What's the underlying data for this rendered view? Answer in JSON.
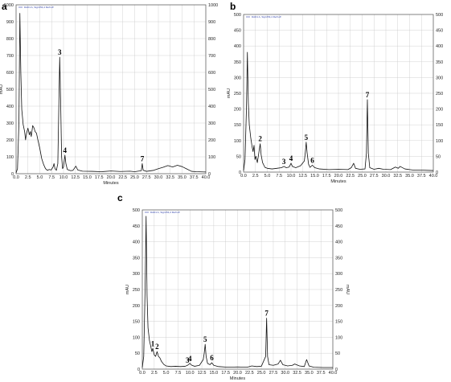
{
  "chart_data": [
    {
      "type": "line",
      "panel": "a",
      "legend_entry": "DAD1 A, Sig=254,4 Ref=off",
      "xlabel": "Minutes",
      "ylabel_left": "mAU",
      "ylabel_right": "",
      "xlim": [
        0,
        40
      ],
      "ylim": [
        0,
        1000
      ],
      "x_ticks": [
        "0.0",
        "2.5",
        "5.0",
        "7.5",
        "10.0",
        "12.5",
        "15.0",
        "17.5",
        "20.0",
        "22.5",
        "25.0",
        "27.5",
        "30.0",
        "32.5",
        "35.0",
        "37.5",
        "40.0"
      ],
      "y_ticks": [
        "0",
        "100",
        "200",
        "300",
        "400",
        "500",
        "600",
        "700",
        "800",
        "900",
        "1000"
      ],
      "grid": true,
      "series": [
        {
          "values": [
            [
              0.0,
              5
            ],
            [
              0.3,
              30
            ],
            [
              0.6,
              300
            ],
            [
              0.8,
              950
            ],
            [
              1.0,
              600
            ],
            [
              1.2,
              380
            ],
            [
              1.5,
              290
            ],
            [
              1.8,
              250
            ],
            [
              2.0,
              200
            ],
            [
              2.2,
              240
            ],
            [
              2.5,
              270
            ],
            [
              2.8,
              230
            ],
            [
              3.0,
              250
            ],
            [
              3.2,
              220
            ],
            [
              3.5,
              285
            ],
            [
              3.8,
              270
            ],
            [
              4.0,
              250
            ],
            [
              4.3,
              240
            ],
            [
              4.6,
              200
            ],
            [
              5.0,
              150
            ],
            [
              5.4,
              90
            ],
            [
              5.8,
              55
            ],
            [
              6.2,
              30
            ],
            [
              6.6,
              20
            ],
            [
              7.0,
              25
            ],
            [
              7.4,
              22
            ],
            [
              7.8,
              40
            ],
            [
              8.0,
              60
            ],
            [
              8.2,
              30
            ],
            [
              8.5,
              20
            ],
            [
              8.8,
              60
            ],
            [
              9.0,
              380
            ],
            [
              9.2,
              690
            ],
            [
              9.4,
              420
            ],
            [
              9.6,
              100
            ],
            [
              9.8,
              30
            ],
            [
              10.0,
              40
            ],
            [
              10.3,
              110
            ],
            [
              10.5,
              60
            ],
            [
              10.8,
              25
            ],
            [
              11.5,
              18
            ],
            [
              12.0,
              20
            ],
            [
              12.6,
              45
            ],
            [
              13.0,
              22
            ],
            [
              14.0,
              15
            ],
            [
              16.0,
              14
            ],
            [
              18.0,
              12
            ],
            [
              20.0,
              16
            ],
            [
              22.0,
              13
            ],
            [
              24.0,
              15
            ],
            [
              25.0,
              12
            ],
            [
              26.4,
              18
            ],
            [
              26.6,
              60
            ],
            [
              26.8,
              20
            ],
            [
              27.5,
              14
            ],
            [
              29.0,
              20
            ],
            [
              30.0,
              30
            ],
            [
              31.0,
              38
            ],
            [
              32.0,
              48
            ],
            [
              33.0,
              40
            ],
            [
              34.0,
              50
            ],
            [
              35.0,
              42
            ],
            [
              36.0,
              28
            ],
            [
              37.0,
              14
            ],
            [
              38.0,
              12
            ],
            [
              40.0,
              10
            ]
          ]
        }
      ],
      "peaks": [
        {
          "label": "3",
          "x": 9.2,
          "y": 690
        },
        {
          "label": "4",
          "x": 10.3,
          "y": 110
        },
        {
          "label": "7",
          "x": 26.6,
          "y": 60
        }
      ]
    },
    {
      "type": "line",
      "panel": "b",
      "legend_entry": "DAD1 A, Sig=254,4 Ref=off",
      "xlabel": "Minutes",
      "ylabel_left": "mAU",
      "ylabel_right": "",
      "xlim": [
        0,
        40
      ],
      "ylim": [
        0,
        500
      ],
      "x_ticks": [
        "0.0",
        "2.5",
        "5.0",
        "7.5",
        "10.0",
        "12.5",
        "15.0",
        "17.5",
        "20.0",
        "22.5",
        "25.0",
        "27.5",
        "30.0",
        "32.5",
        "35.0",
        "37.5",
        "40.0"
      ],
      "y_ticks": [
        "0",
        "50",
        "100",
        "150",
        "200",
        "250",
        "300",
        "350",
        "400",
        "450",
        "500"
      ],
      "grid": true,
      "series": [
        {
          "values": [
            [
              0.0,
              5
            ],
            [
              0.3,
              40
            ],
            [
              0.6,
              200
            ],
            [
              0.8,
              380
            ],
            [
              1.0,
              220
            ],
            [
              1.2,
              150
            ],
            [
              1.5,
              110
            ],
            [
              1.8,
              80
            ],
            [
              2.0,
              65
            ],
            [
              2.2,
              85
            ],
            [
              2.4,
              40
            ],
            [
              2.6,
              50
            ],
            [
              2.9,
              30
            ],
            [
              3.2,
              60
            ],
            [
              3.5,
              90
            ],
            [
              3.7,
              55
            ],
            [
              4.0,
              30
            ],
            [
              4.5,
              15
            ],
            [
              5.0,
              12
            ],
            [
              6.0,
              10
            ],
            [
              7.0,
              12
            ],
            [
              8.0,
              14
            ],
            [
              8.5,
              18
            ],
            [
              9.0,
              14
            ],
            [
              9.6,
              16
            ],
            [
              10.0,
              28
            ],
            [
              10.3,
              18
            ],
            [
              11.0,
              14
            ],
            [
              12.0,
              20
            ],
            [
              12.8,
              35
            ],
            [
              13.0,
              60
            ],
            [
              13.2,
              95
            ],
            [
              13.4,
              60
            ],
            [
              13.7,
              25
            ],
            [
              14.0,
              15
            ],
            [
              14.5,
              22
            ],
            [
              15.0,
              14
            ],
            [
              16.0,
              10
            ],
            [
              18.0,
              8
            ],
            [
              20.0,
              9
            ],
            [
              22.0,
              8
            ],
            [
              22.7,
              14
            ],
            [
              23.2,
              28
            ],
            [
              23.6,
              12
            ],
            [
              24.5,
              9
            ],
            [
              25.6,
              10
            ],
            [
              25.9,
              60
            ],
            [
              26.1,
              230
            ],
            [
              26.3,
              60
            ],
            [
              26.6,
              14
            ],
            [
              27.5,
              9
            ],
            [
              28.5,
              12
            ],
            [
              29.5,
              9
            ],
            [
              31.0,
              8
            ],
            [
              32.0,
              16
            ],
            [
              32.6,
              12
            ],
            [
              33.0,
              18
            ],
            [
              34.0,
              10
            ],
            [
              35.0,
              8
            ],
            [
              36.0,
              6
            ],
            [
              38.0,
              6
            ],
            [
              40.0,
              5
            ]
          ]
        }
      ],
      "peaks": [
        {
          "label": "2",
          "x": 3.5,
          "y": 90
        },
        {
          "label": "3",
          "x": 8.5,
          "y": 18
        },
        {
          "label": "4",
          "x": 10.0,
          "y": 28
        },
        {
          "label": "5",
          "x": 13.2,
          "y": 95
        },
        {
          "label": "6",
          "x": 14.5,
          "y": 22
        },
        {
          "label": "7",
          "x": 26.1,
          "y": 230
        }
      ]
    },
    {
      "type": "line",
      "panel": "c",
      "legend_entry": "DAD1 A, Sig=254,4 Ref=off",
      "xlabel": "Minutes",
      "ylabel_left": "mAU",
      "ylabel_right": "mAU",
      "xlim": [
        0,
        40
      ],
      "ylim": [
        0,
        500
      ],
      "x_ticks": [
        "0.0",
        "2.5",
        "5.0",
        "7.5",
        "10.0",
        "12.5",
        "15.0",
        "17.5",
        "20.0",
        "22.5",
        "25.0",
        "27.5",
        "30.0",
        "32.5",
        "35.0",
        "37.5",
        "40.0"
      ],
      "y_ticks": [
        "0",
        "50",
        "100",
        "150",
        "200",
        "250",
        "300",
        "350",
        "400",
        "450",
        "500"
      ],
      "grid": true,
      "series": [
        {
          "values": [
            [
              0.0,
              5
            ],
            [
              0.3,
              40
            ],
            [
              0.6,
              260
            ],
            [
              0.8,
              480
            ],
            [
              1.0,
              230
            ],
            [
              1.2,
              130
            ],
            [
              1.5,
              90
            ],
            [
              1.8,
              70
            ],
            [
              2.0,
              55
            ],
            [
              2.2,
              65
            ],
            [
              2.5,
              45
            ],
            [
              2.8,
              40
            ],
            [
              3.1,
              55
            ],
            [
              3.4,
              40
            ],
            [
              3.7,
              35
            ],
            [
              4.0,
              25
            ],
            [
              4.5,
              15
            ],
            [
              5.0,
              10
            ],
            [
              6.0,
              8
            ],
            [
              7.0,
              9
            ],
            [
              8.0,
              8
            ],
            [
              9.0,
              9
            ],
            [
              9.5,
              12
            ],
            [
              10.0,
              18
            ],
            [
              10.4,
              12
            ],
            [
              11.0,
              9
            ],
            [
              12.0,
              12
            ],
            [
              12.8,
              30
            ],
            [
              13.0,
              50
            ],
            [
              13.2,
              78
            ],
            [
              13.4,
              40
            ],
            [
              13.7,
              18
            ],
            [
              14.2,
              14
            ],
            [
              14.6,
              20
            ],
            [
              15.0,
              12
            ],
            [
              16.0,
              8
            ],
            [
              18.0,
              6
            ],
            [
              20.0,
              7
            ],
            [
              22.0,
              6
            ],
            [
              23.0,
              10
            ],
            [
              24.0,
              8
            ],
            [
              25.0,
              9
            ],
            [
              25.9,
              40
            ],
            [
              26.1,
              160
            ],
            [
              26.3,
              40
            ],
            [
              26.6,
              14
            ],
            [
              27.5,
              12
            ],
            [
              28.5,
              16
            ],
            [
              29.0,
              28
            ],
            [
              29.5,
              14
            ],
            [
              30.5,
              10
            ],
            [
              31.5,
              12
            ],
            [
              32.0,
              16
            ],
            [
              33.0,
              10
            ],
            [
              34.0,
              8
            ],
            [
              34.5,
              30
            ],
            [
              35.0,
              10
            ],
            [
              36.0,
              6
            ],
            [
              38.0,
              5
            ],
            [
              40.0,
              5
            ]
          ]
        }
      ],
      "peaks": [
        {
          "label": "1",
          "x": 2.2,
          "y": 65
        },
        {
          "label": "2",
          "x": 3.1,
          "y": 55
        },
        {
          "label": "3",
          "x": 9.5,
          "y": 12
        },
        {
          "label": "4",
          "x": 10.0,
          "y": 18
        },
        {
          "label": "5",
          "x": 13.2,
          "y": 78
        },
        {
          "label": "6",
          "x": 14.6,
          "y": 20
        },
        {
          "label": "7",
          "x": 26.1,
          "y": 160
        }
      ]
    }
  ]
}
